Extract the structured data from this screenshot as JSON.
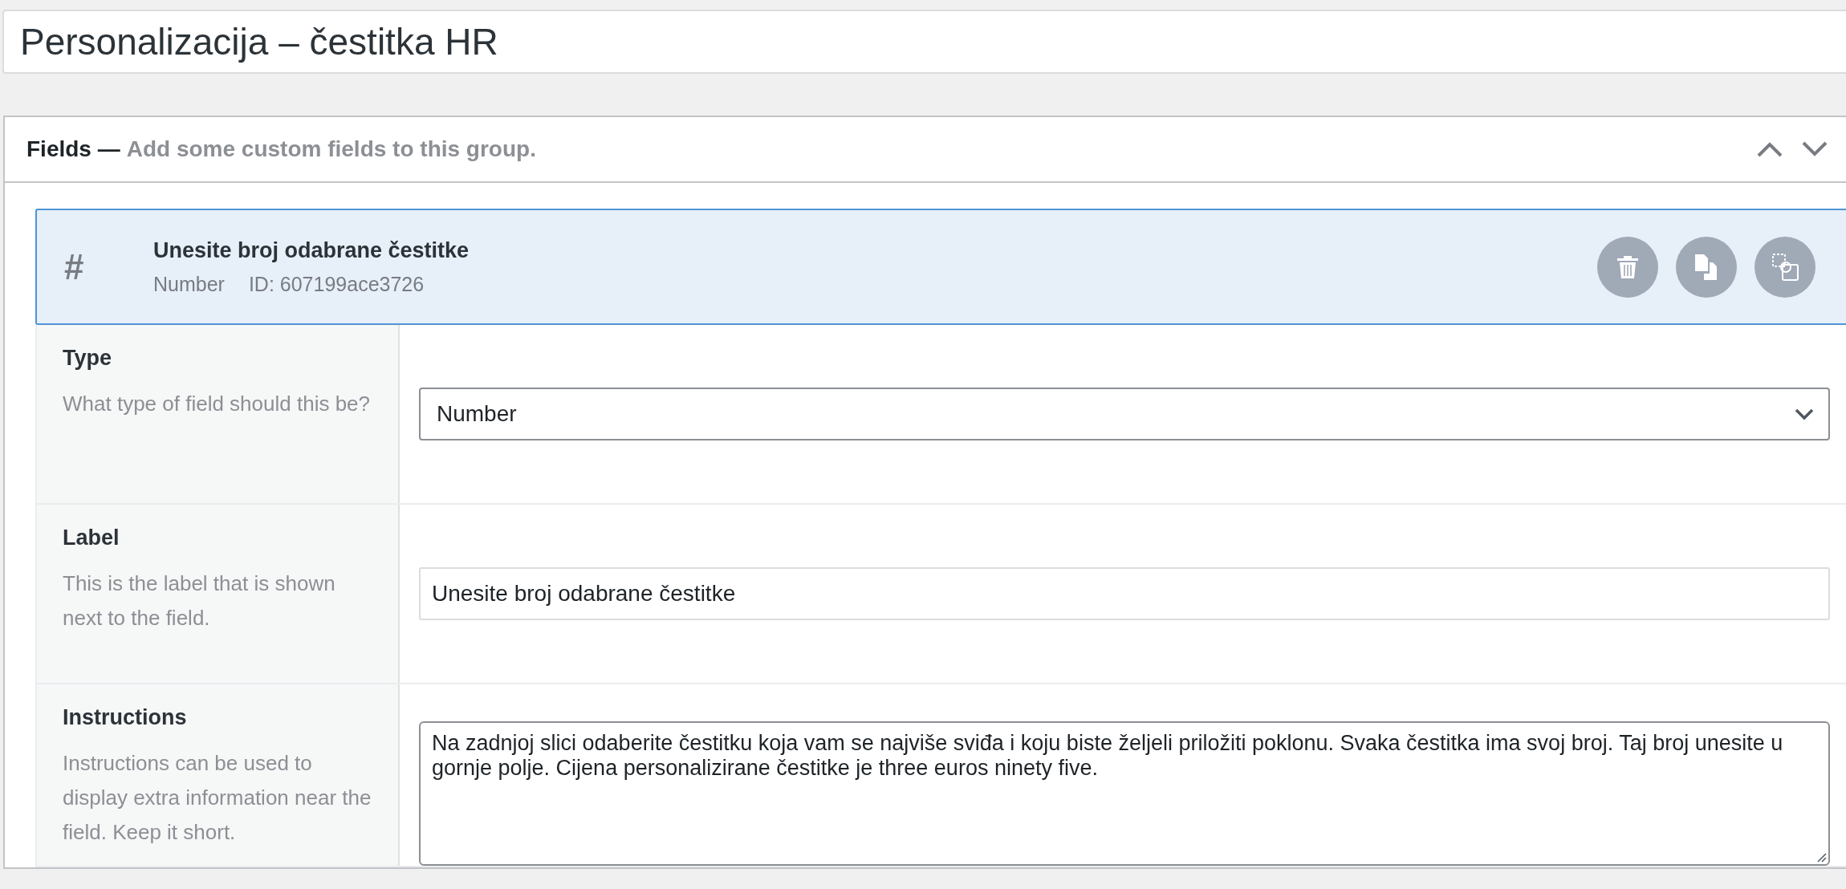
{
  "title_field": {
    "value": "Personalizacija – čestitka HR"
  },
  "fields_panel": {
    "title": "Fields —",
    "description": "Add some custom fields to this group.",
    "field": {
      "type_glyph": "#",
      "label": "Unesite broj odabrane čestitke",
      "type": "Number",
      "id": "ID: 607199ace3726",
      "selected": true,
      "settings": [
        {
          "kind": "select",
          "label": "Type",
          "help": "What type of field should this be?",
          "value": "Number"
        },
        {
          "kind": "text",
          "label": "Label",
          "help": "This is the label that is shown next to the field.",
          "value": "Unesite broj odabrane čestitke"
        },
        {
          "kind": "textarea",
          "label": "Instructions",
          "help": "Instructions can be used to display extra information near the field. Keep it short.",
          "value": "Na zadnjoj slici odaberite čestitku koja vam se najviše sviđa i koju biste željeli priložiti poklonu. Svaka čestitka ima svoj broj. Taj broj unesite u gornje polje. Cijena personalizirane čestitke je three euros ninety five."
        }
      ]
    }
  }
}
